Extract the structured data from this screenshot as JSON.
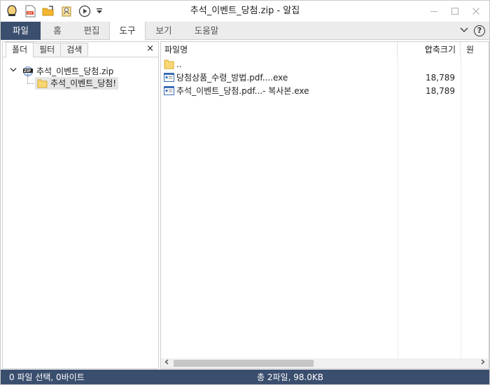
{
  "window": {
    "title": "추석_이벤트_당첨.zip - 알집"
  },
  "qat": {
    "icons": [
      "app-logo-icon",
      "new-zip-icon",
      "open-folder-icon",
      "extract-icon",
      "play-icon",
      "dropdown-icon"
    ]
  },
  "ribbon": {
    "tabs": [
      {
        "label": "파일",
        "kind": "file"
      },
      {
        "label": "홈",
        "kind": "normal"
      },
      {
        "label": "편집",
        "kind": "normal"
      },
      {
        "label": "도구",
        "kind": "active"
      },
      {
        "label": "보기",
        "kind": "normal"
      },
      {
        "label": "도움말",
        "kind": "normal"
      }
    ],
    "help_label": "?"
  },
  "left_pane": {
    "tabs": [
      "폴더",
      "필터",
      "검색"
    ],
    "close_label": "×",
    "tree": {
      "root_label": "추석_이벤트_당첨.zip",
      "child_label": "추석_이벤트_당첨!"
    }
  },
  "file_list": {
    "columns": {
      "name": "파일명",
      "size": "압축크기",
      "more": "원"
    },
    "rows": [
      {
        "name": "..",
        "size": "",
        "icon": "folder-icon"
      },
      {
        "name": "당첨상품_수령_방법.pdf....exe",
        "size": "18,789",
        "icon": "exe-icon"
      },
      {
        "name": "추석_이벤트_당첨.pdf...- 복사본.exe",
        "size": "18,789",
        "icon": "exe-icon"
      }
    ]
  },
  "status": {
    "left": "0 파일 선택,  0바이트",
    "right": "총 2파일,  98.0KB"
  },
  "colors": {
    "accent": "#3a4e6e",
    "ribbon_bg": "#ececec",
    "selection": "#e5e5e5"
  }
}
